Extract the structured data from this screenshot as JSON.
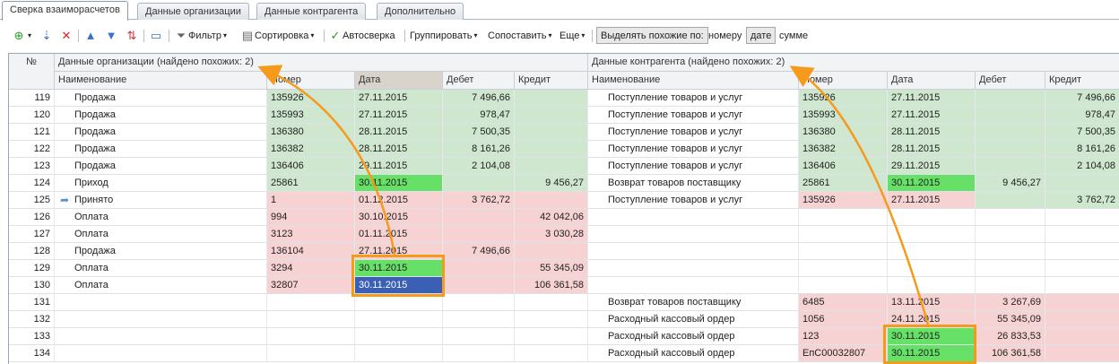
{
  "tabs": [
    "Сверка взаиморасчетов",
    "Данные организации",
    "Данные контрагента",
    "Дополнительно"
  ],
  "toolbar": {
    "filter": "Фильтр",
    "sort": "Сортировка",
    "autocheck": "Автосверка",
    "group": "Группировать",
    "compare": "Сопоставить",
    "more": "Еще",
    "highlight_label": "Выделять похожие по:",
    "by_number": "номеру",
    "by_date": "дате",
    "by_sum": "сумме"
  },
  "header": {
    "num": "№",
    "org_group": "Данные организации (найдено похожих: 2)",
    "contr_group": "Данные контрагента (найдено похожих: 2)",
    "name": "Наименование",
    "number": "Номер",
    "date": "Дата",
    "debit": "Дебет",
    "credit": "Кредит"
  },
  "rows": [
    {
      "n": "119",
      "on": "Продажа",
      "onum": "135926",
      "od": "27.11.2015",
      "odb": "7 496,66",
      "ocr": "",
      "cn": "Поступление товаров и услуг",
      "cnum": "135926",
      "cd": "27.11.2015",
      "cdb": "",
      "ccr": "7 496,66"
    },
    {
      "n": "120",
      "on": "Продажа",
      "onum": "135993",
      "od": "27.11.2015",
      "odb": "978,47",
      "ocr": "",
      "cn": "Поступление товаров и услуг",
      "cnum": "135993",
      "cd": "27.11.2015",
      "cdb": "",
      "ccr": "978,47"
    },
    {
      "n": "121",
      "on": "Продажа",
      "onum": "136380",
      "od": "28.11.2015",
      "odb": "7 500,35",
      "ocr": "",
      "cn": "Поступление товаров и услуг",
      "cnum": "136380",
      "cd": "28.11.2015",
      "cdb": "",
      "ccr": "7 500,35"
    },
    {
      "n": "122",
      "on": "Продажа",
      "onum": "136382",
      "od": "28.11.2015",
      "odb": "8 161,26",
      "ocr": "",
      "cn": "Поступление товаров и услуг",
      "cnum": "136382",
      "cd": "28.11.2015",
      "cdb": "",
      "ccr": "8 161,26"
    },
    {
      "n": "123",
      "on": "Продажа",
      "onum": "136406",
      "od": "29.11.2015",
      "odb": "2 104,08",
      "ocr": "",
      "cn": "Поступление товаров и услуг",
      "cnum": "136406",
      "cd": "29.11.2015",
      "cdb": "",
      "ccr": "2 104,08"
    },
    {
      "n": "124",
      "on": "Приход",
      "onum": "25861",
      "od": "30.11.2015",
      "odb": "",
      "ocr": "9 456,27",
      "cn": "Возврат товаров поставщику",
      "cnum": "25861",
      "cd": "30.11.2015",
      "cdb": "9 456,27",
      "ccr": ""
    },
    {
      "n": "125",
      "on": "Принято",
      "onum": "1",
      "od": "01.12.2015",
      "odb": "3 762,72",
      "ocr": "",
      "cn": "Поступление товаров и услуг",
      "cnum": "135926",
      "cd": "27.11.2015",
      "cdb": "",
      "ccr": "3 762,72"
    },
    {
      "n": "126",
      "on": "Оплата",
      "onum": "994",
      "od": "30.10.2015",
      "odb": "",
      "ocr": "42 042,06",
      "cn": "",
      "cnum": "",
      "cd": "",
      "cdb": "",
      "ccr": ""
    },
    {
      "n": "127",
      "on": "Оплата",
      "onum": "3123",
      "od": "01.11.2015",
      "odb": "",
      "ocr": "3 030,28",
      "cn": "",
      "cnum": "",
      "cd": "",
      "cdb": "",
      "ccr": ""
    },
    {
      "n": "128",
      "on": "Продажа",
      "onum": "136104",
      "od": "27.11.2015",
      "odb": "7 496,66",
      "ocr": "",
      "cn": "",
      "cnum": "",
      "cd": "",
      "cdb": "",
      "ccr": ""
    },
    {
      "n": "129",
      "on": "Оплата",
      "onum": "3294",
      "od": "30.11.2015",
      "odb": "",
      "ocr": "55 345,09",
      "cn": "",
      "cnum": "",
      "cd": "",
      "cdb": "",
      "ccr": ""
    },
    {
      "n": "130",
      "on": "Оплата",
      "onum": "32807",
      "od": "30.11.2015",
      "odb": "",
      "ocr": "106 361,58",
      "cn": "",
      "cnum": "",
      "cd": "",
      "cdb": "",
      "ccr": ""
    },
    {
      "n": "131",
      "on": "",
      "onum": "",
      "od": "",
      "odb": "",
      "ocr": "",
      "cn": "Возврат товаров поставщику",
      "cnum": "6485",
      "cd": "13.11.2015",
      "cdb": "3 267,69",
      "ccr": ""
    },
    {
      "n": "132",
      "on": "",
      "onum": "",
      "od": "",
      "odb": "",
      "ocr": "",
      "cn": "Расходный кассовый ордер",
      "cnum": "1056",
      "cd": "24.11.2015",
      "cdb": "55 345,09",
      "ccr": ""
    },
    {
      "n": "133",
      "on": "",
      "onum": "",
      "od": "",
      "odb": "",
      "ocr": "",
      "cn": "Расходный кассовый ордер",
      "cnum": "123",
      "cd": "30.11.2015",
      "cdb": "26 833,53",
      "ccr": ""
    },
    {
      "n": "134",
      "on": "",
      "onum": "",
      "od": "",
      "odb": "",
      "ocr": "",
      "cn": "Расходный кассовый ордер",
      "cnum": "ЕпС00032807",
      "cd": "30.11.2015",
      "cdb": "106 361,58",
      "ccr": ""
    }
  ],
  "colors": {
    "matched": "#cfe6cf",
    "unmatched": "#f7d2d2",
    "similar": "#66e066",
    "selected": "#3b5fb5",
    "callout": "#f59a1a"
  }
}
